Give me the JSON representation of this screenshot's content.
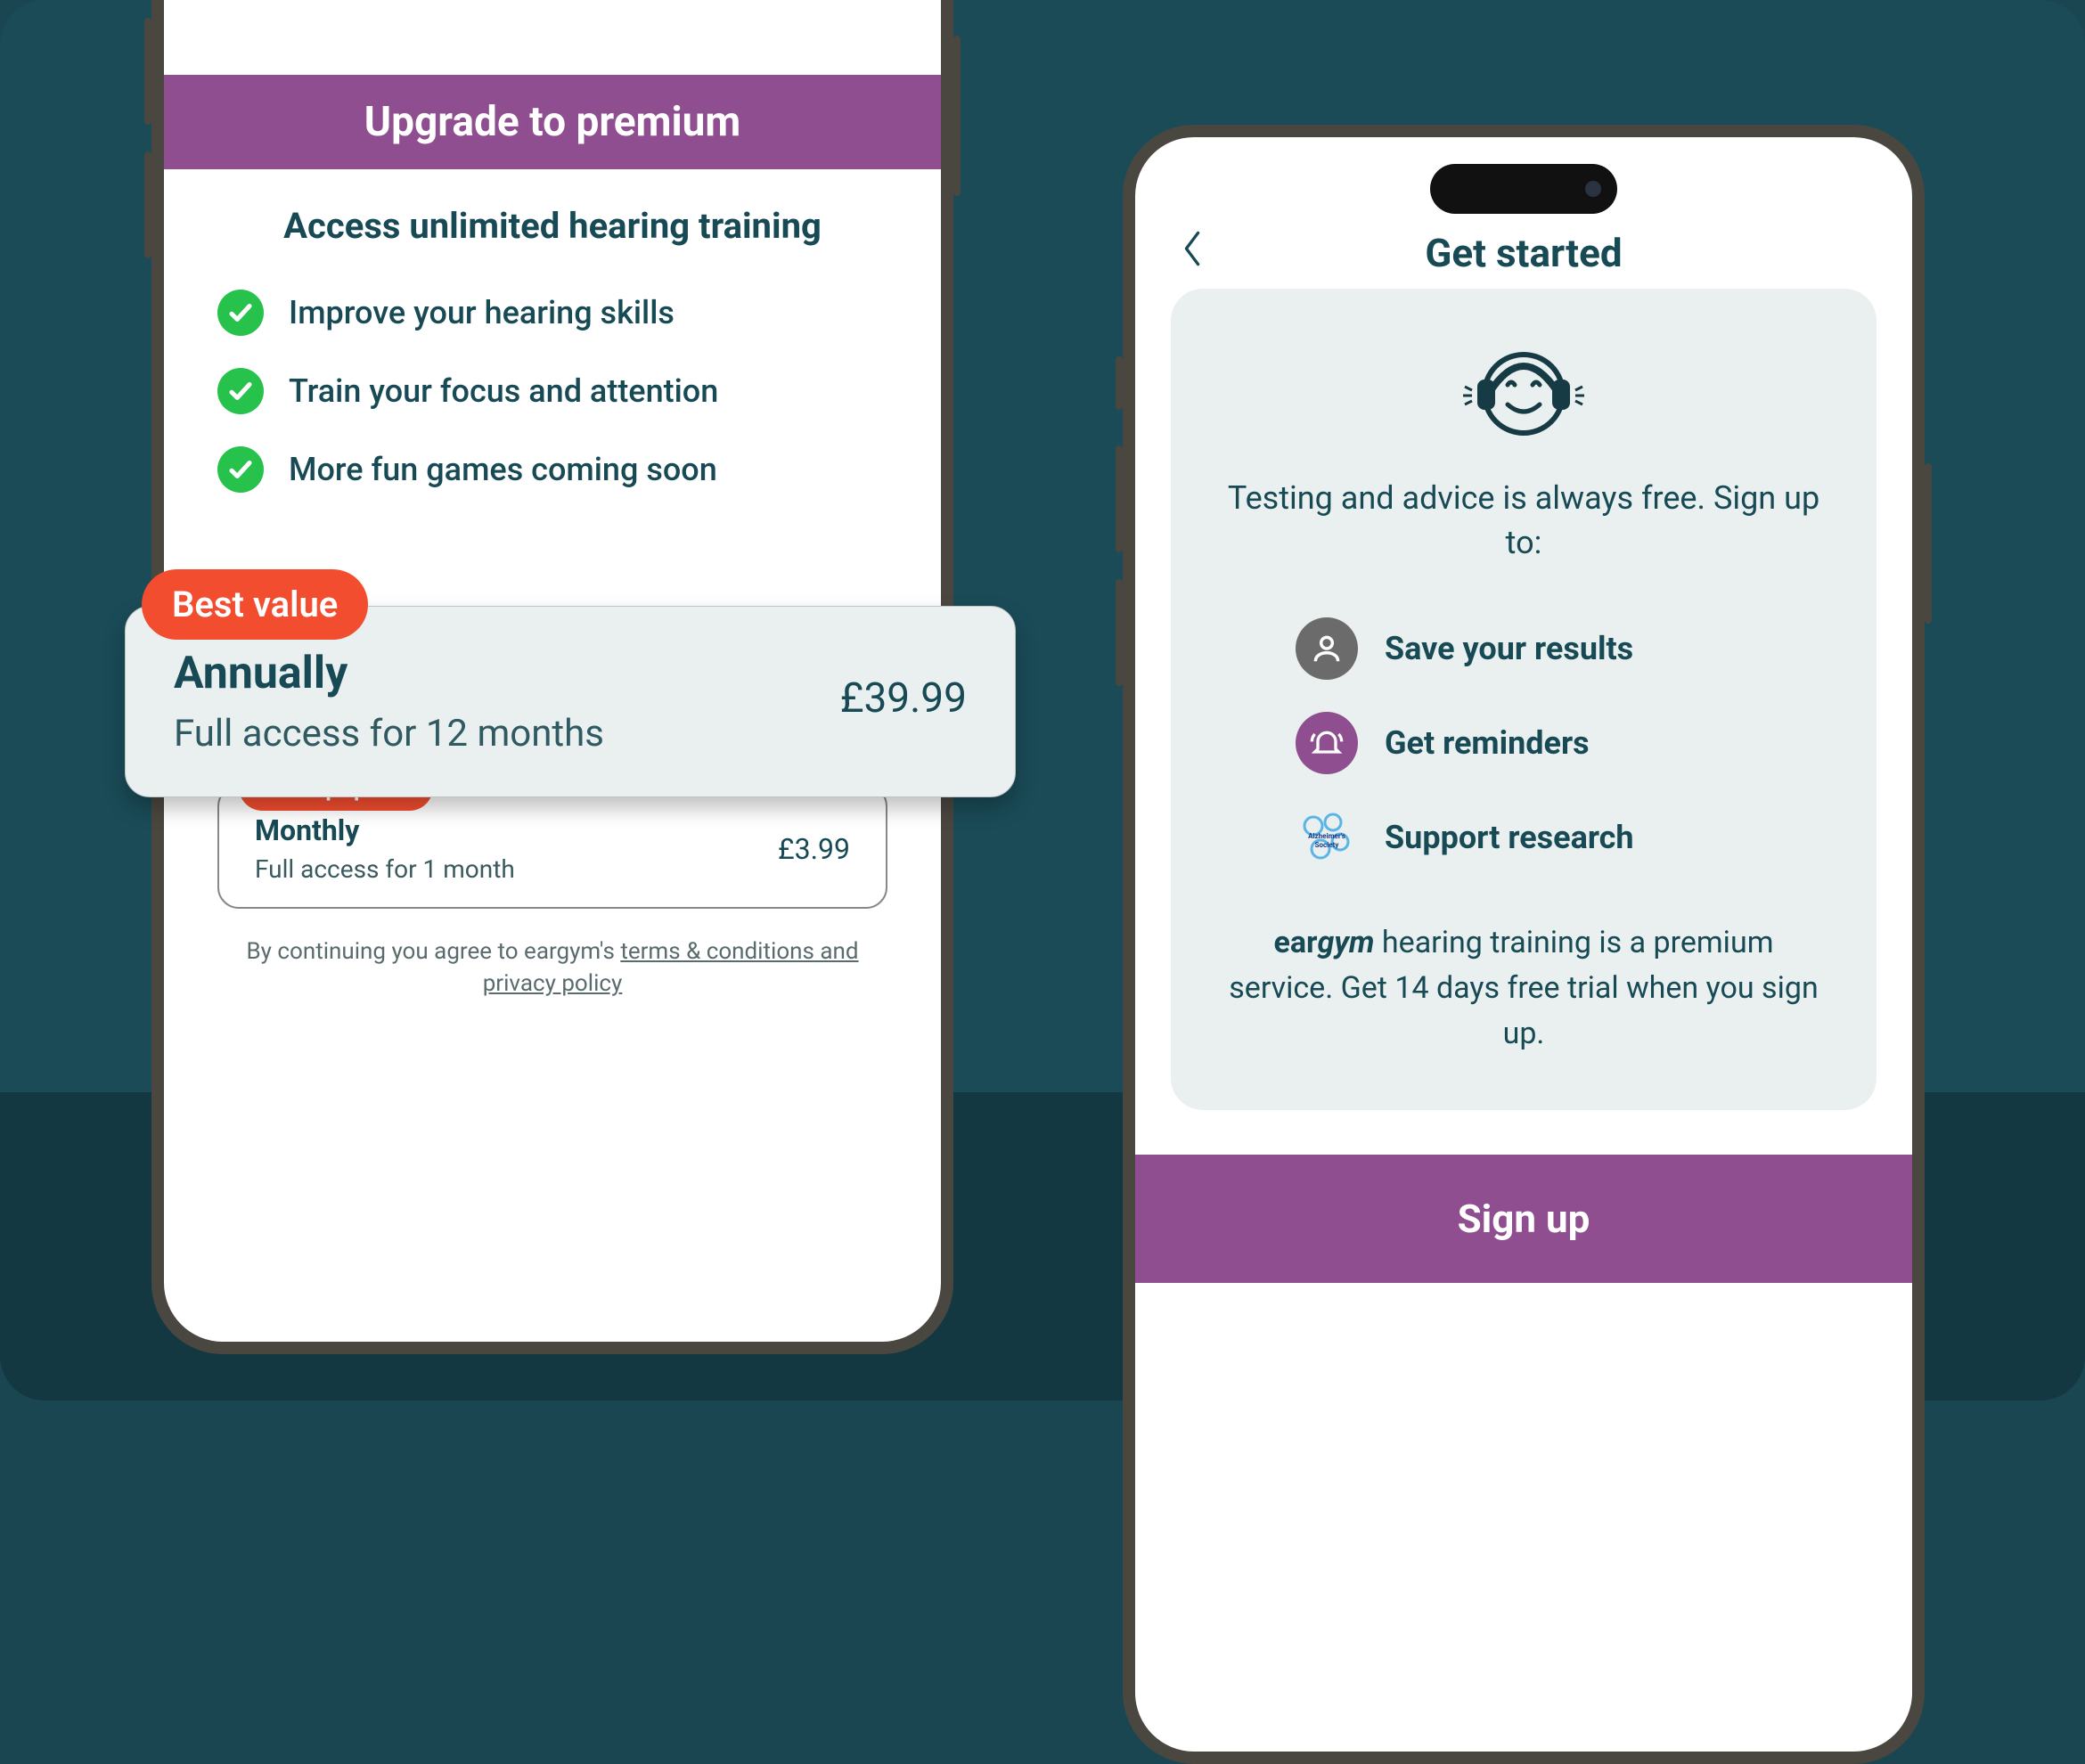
{
  "left": {
    "header": "Upgrade to premium",
    "subhead": "Access unlimited hearing training",
    "benefits": [
      "Improve your hearing skills",
      "Train your focus and attention",
      "More fun games coming soon"
    ],
    "annual": {
      "badge": "Best value",
      "name": "Annually",
      "desc": "Full access for 12 months",
      "price": "£39.99"
    },
    "monthly": {
      "badge": "Most popular",
      "name": "Monthly",
      "desc": "Full access for 1 month",
      "price": "£3.99"
    },
    "terms_prefix": "By continuing you agree to eargym's ",
    "terms_link": "terms & conditions and privacy policy"
  },
  "right": {
    "title": "Get started",
    "intro": "Testing and advice is always free. Sign up to:",
    "features": [
      "Save your results",
      "Get reminders",
      "Support research"
    ],
    "note_suffix": " hearing training is a premium service. Get 14 days free trial when you sign up.",
    "signup": "Sign up"
  }
}
